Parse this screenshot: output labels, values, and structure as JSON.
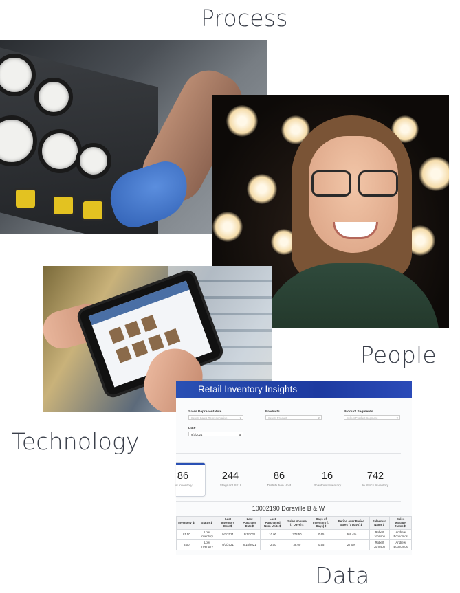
{
  "labels": {
    "process": "Process",
    "people": "People",
    "technology": "Technology",
    "data": "Data"
  },
  "dashboard": {
    "title": "Retail Inventory Insights",
    "filters": {
      "sales_rep_label": "Sales Representative",
      "sales_rep_placeholder": "Select Sales Representative",
      "products_label": "Products",
      "products_placeholder": "Select Product",
      "segments_label": "Product Segments",
      "segments_placeholder": "Select Product Segment",
      "date_label": "Date",
      "date_value": "9/3/2021"
    },
    "kpis": [
      {
        "value": "86",
        "label": "w Inventory"
      },
      {
        "value": "244",
        "label": "Stagnant SKU"
      },
      {
        "value": "86",
        "label": "Distribution Void"
      },
      {
        "value": "16",
        "label": "Phantom Inventory"
      },
      {
        "value": "742",
        "label": "In Stock Inventory"
      }
    ],
    "store_title": "10002190 Doraville B & W",
    "table": {
      "headers": [
        "Inventory ⇕",
        "Status⇕",
        "Last Inventory Date⇕",
        "Last Purchase Date⇕",
        "Last Purchased Num Units⇕",
        "Sales Volume (7 Days)⇕",
        "Days of Inventory (7 Days)⇕",
        "Period over Period Sales (7 Days)⇕",
        "Salesman Name⇕",
        "Sales Manager Name⇕"
      ],
      "rows": [
        [
          "81.50",
          "Low Inventory",
          "9/3/2021",
          "9/1/2021",
          "10.00",
          "278.50",
          "0.65",
          "369.4%",
          "Robert Johnson",
          "Andrew Economos"
        ],
        [
          "3.00",
          "Low Inventory",
          "9/3/2021",
          "8/18/2021",
          "-2.00",
          "38.00",
          "0.55",
          "27.0%",
          "Robert Johnson",
          "Andrew Economos"
        ]
      ]
    }
  }
}
